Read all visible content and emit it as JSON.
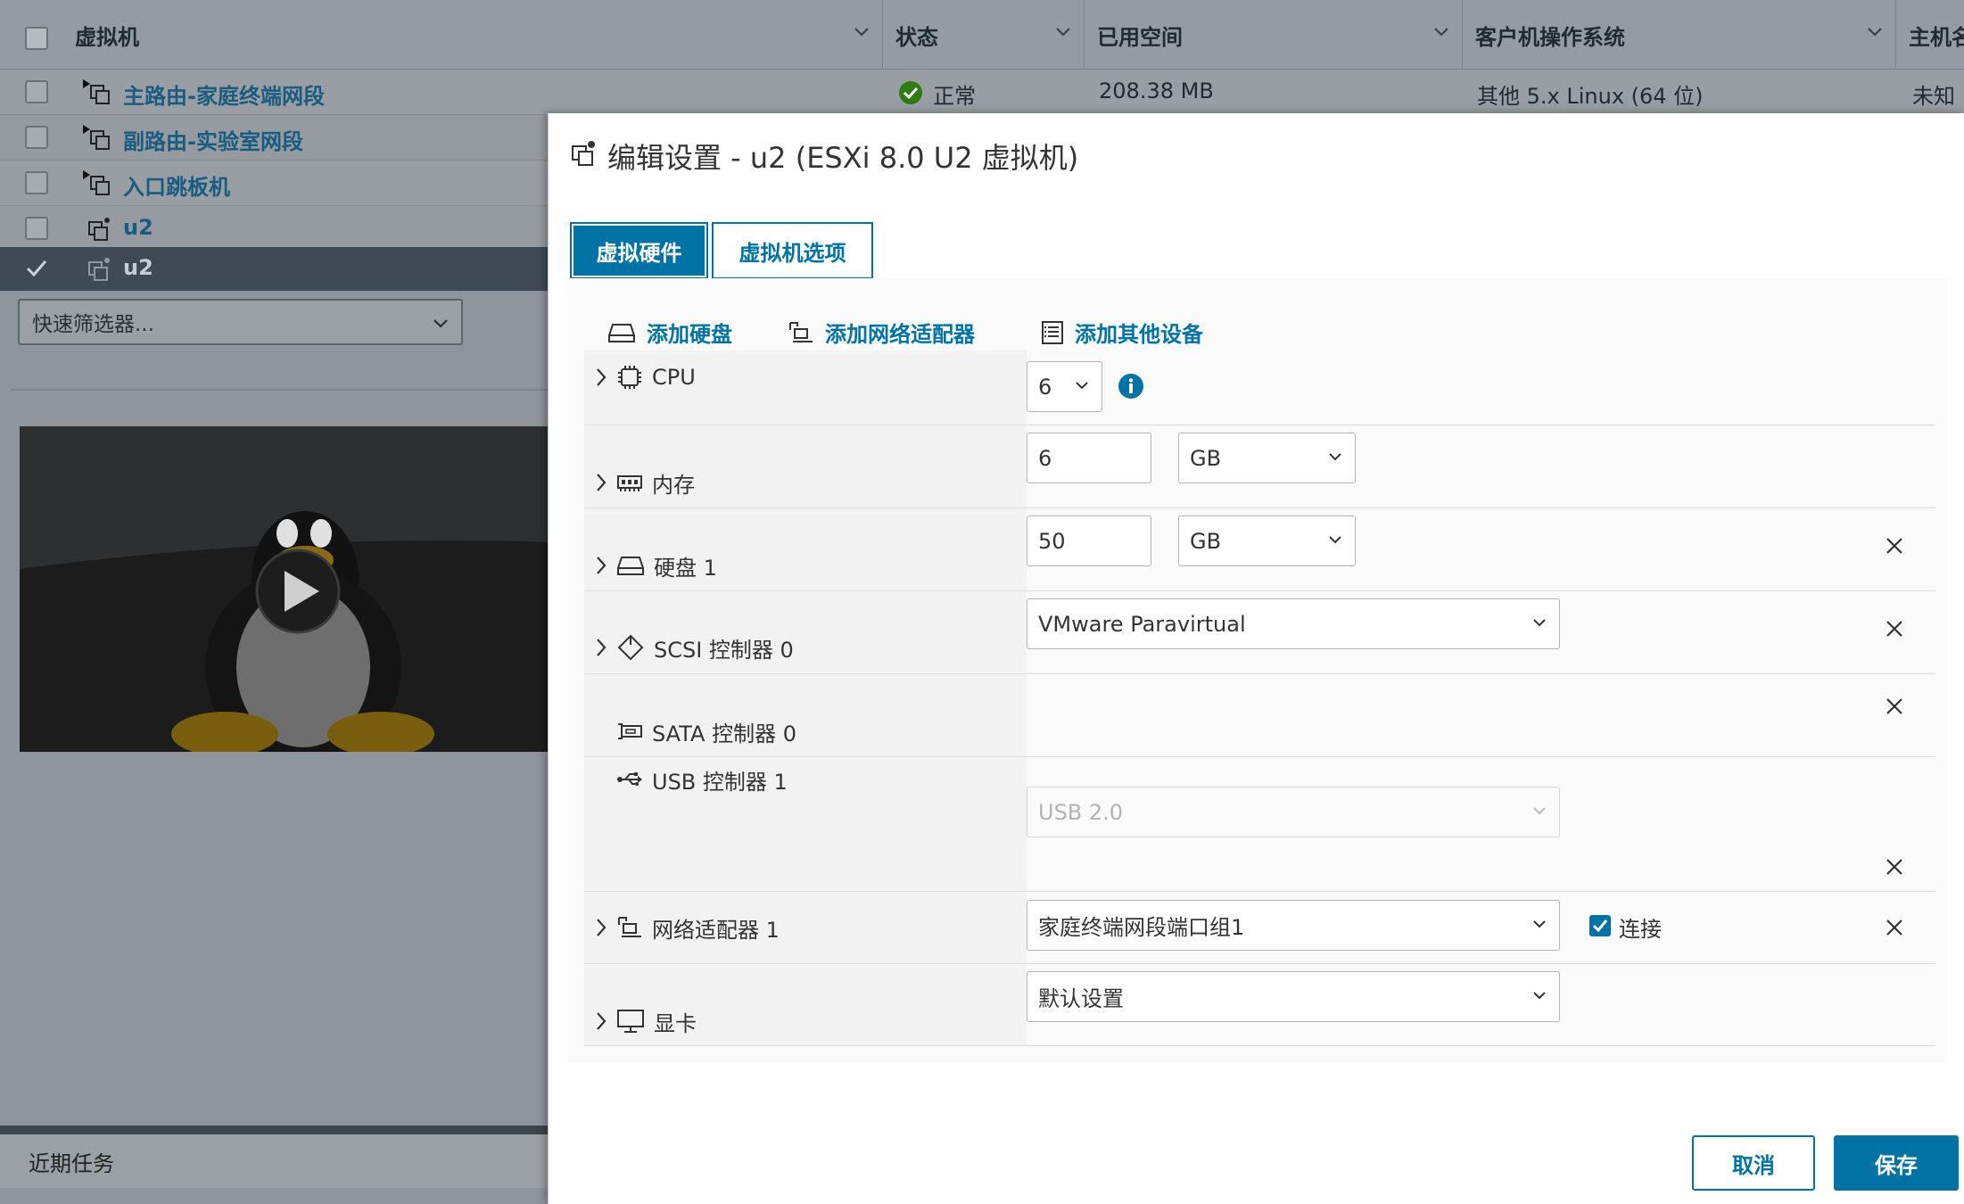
{
  "grid": {
    "headers": {
      "name": "虚拟机",
      "status": "状态",
      "used_space": "已用空间",
      "guest_os": "客户机操作系统",
      "host_name": "主机名"
    },
    "rows": [
      {
        "name": "主路由-家庭终端网段",
        "status": "正常",
        "used_space": "208.38 MB",
        "guest_os": "其他 5.x Linux (64 位)",
        "host_name": "未知"
      },
      {
        "name": "副路由-实验室网段"
      },
      {
        "name": "入口跳板机"
      },
      {
        "name": "u2"
      },
      {
        "name": "u2",
        "selected": true
      }
    ],
    "quick_filter": "快速筛选器..."
  },
  "recent_tasks": "近期任务",
  "dialog": {
    "title": "编辑设置 - u2 (ESXi 8.0 U2 虚拟机)",
    "tabs": {
      "hardware": "虚拟硬件",
      "options": "虚拟机选项"
    },
    "actions": {
      "add_disk": "添加硬盘",
      "add_nic": "添加网络适配器",
      "add_other": "添加其他设备"
    },
    "hardware": {
      "cpu": {
        "label": "CPU",
        "value": "6"
      },
      "memory": {
        "label": "内存",
        "value": "6",
        "unit": "GB"
      },
      "disk": {
        "label": "硬盘 1",
        "value": "50",
        "unit": "GB"
      },
      "scsi": {
        "label": "SCSI 控制器 0",
        "value": "VMware Paravirtual"
      },
      "sata": {
        "label": "SATA 控制器 0"
      },
      "usb": {
        "label": "USB 控制器 1",
        "value": "USB 2.0"
      },
      "nic": {
        "label": "网络适配器 1",
        "value": "家庭终端网段端口组1",
        "connect_label": "连接",
        "connected": true
      },
      "video": {
        "label": "显卡",
        "value": "默认设置"
      }
    },
    "buttons": {
      "cancel": "取消",
      "save": "保存"
    }
  },
  "colors": {
    "accent": "#0072a3",
    "ok": "#2f8400"
  }
}
